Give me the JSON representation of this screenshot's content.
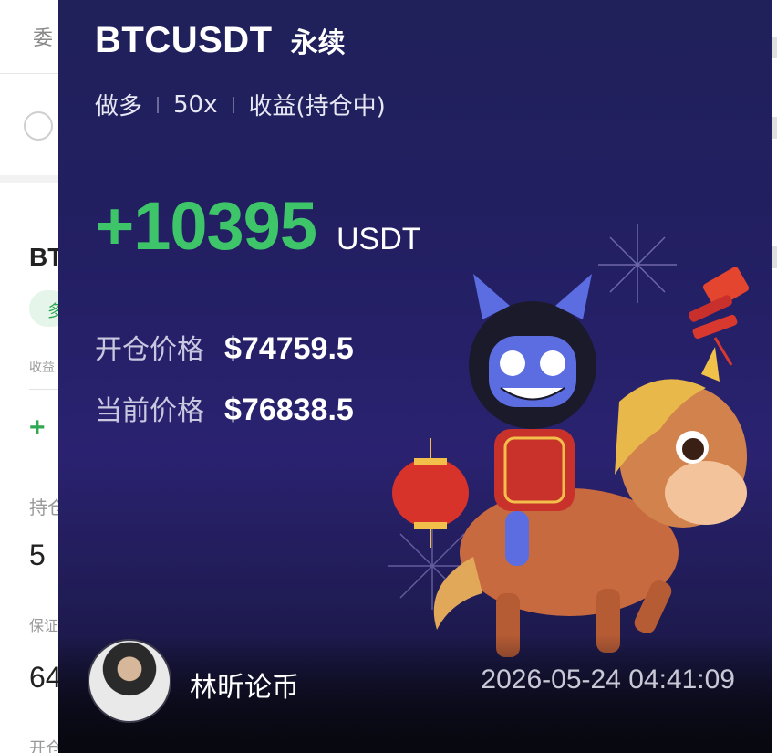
{
  "background_app": {
    "tab_fragment": "委",
    "symbol_fragment": "BT",
    "side_fragment": "多",
    "small_label_1": "收益",
    "pnl_fragment": "+",
    "position_label_fragment": "持仓",
    "position_value_fragment": "5",
    "margin_label_fragment": "保证",
    "margin_value_fragment": "64",
    "bottom_label_fragment": "开仓"
  },
  "card": {
    "symbol": "BTCUSDT",
    "contract_type": "永续",
    "side": "做多",
    "leverage": "50x",
    "pnl_status": "收益(持仓中)",
    "pnl_value": "+10395",
    "pnl_unit": "USDT",
    "entry_price_label": "开仓价格",
    "entry_price": "$74759.5",
    "current_price_label": "当前价格",
    "current_price": "$76838.5",
    "username": "林昕论币",
    "timestamp": "2026-05-24 04:41:09",
    "colors": {
      "profit": "#3ec56a",
      "card_bg": "#231f63"
    }
  }
}
